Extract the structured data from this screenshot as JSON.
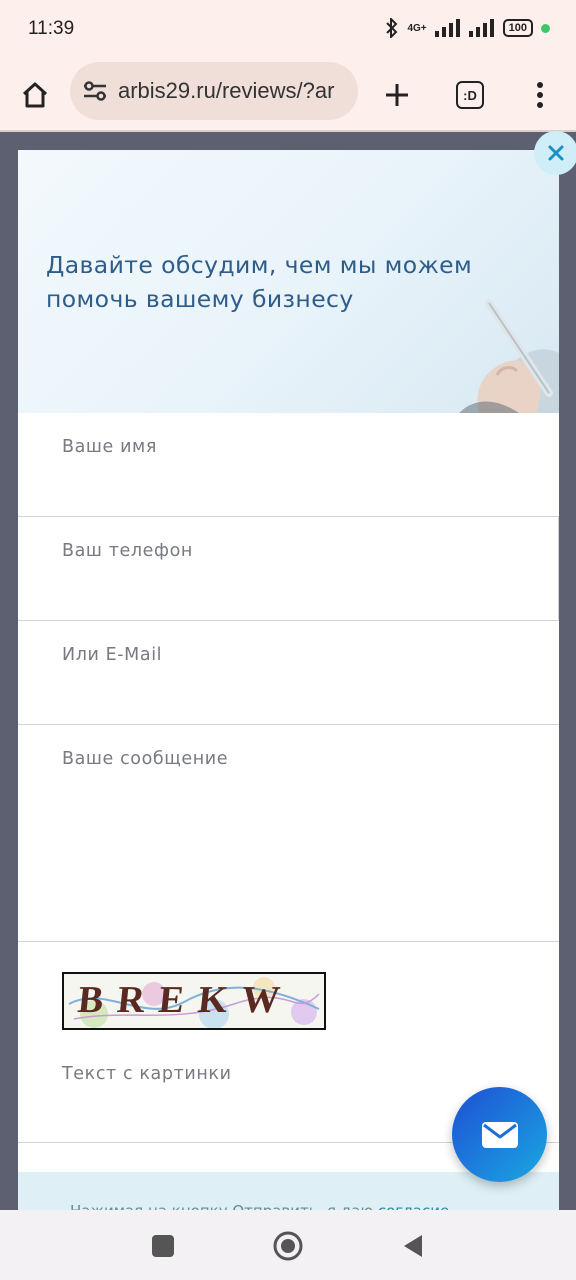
{
  "status_bar": {
    "time": "11:39",
    "network": "4G+",
    "battery": "100"
  },
  "browser": {
    "url": "arbis29.ru/reviews/?ar",
    "home_icon": "home-icon",
    "site_settings_icon": "tune-icon",
    "new_tab_icon": "plus-icon",
    "tabs_icon": "tabs-icon",
    "tabs_label": ":D",
    "menu_icon": "more-vert-icon"
  },
  "modal": {
    "title": "Давайте обсудим, чем мы можем помочь вашему бизнесу",
    "fields": {
      "name_placeholder": "Ваше имя",
      "phone_placeholder": "Ваш телефон",
      "email_placeholder": "Или E-Mail",
      "message_placeholder": "Ваше сообщение",
      "captcha_placeholder": "Текст с картинки"
    },
    "captcha_text": "BREKW",
    "consent_text": "Нажимая на кнопку Отправить, я даю ",
    "consent_link": "согласие",
    "close_icon": "close-icon"
  },
  "fab": {
    "icon": "mail-icon"
  },
  "colors": {
    "accent": "#2e5d8a",
    "fab_start": "#1e4fd6",
    "fab_end": "#1aa8e0",
    "backdrop": "#5d6070"
  }
}
